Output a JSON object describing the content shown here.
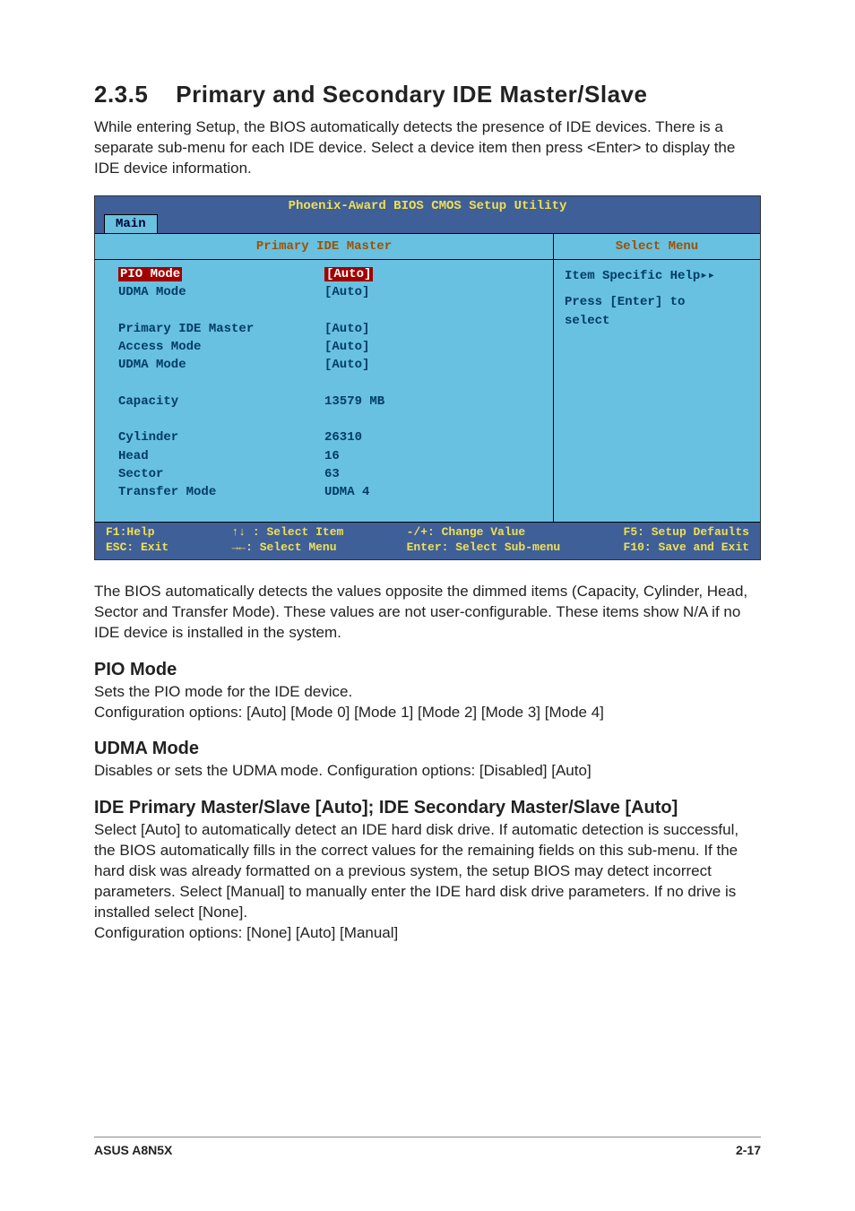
{
  "section": {
    "number": "2.3.5",
    "title": "Primary and Secondary IDE Master/Slave"
  },
  "intro": "While entering Setup, the BIOS automatically detects the presence of IDE devices. There is a separate sub-menu for each IDE device. Select a device item then press <Enter> to display the IDE device information.",
  "bios": {
    "utility_title": "Phoenix-Award BIOS CMOS Setup Utility",
    "tab": "Main",
    "left_heading": "Primary IDE Master",
    "right_heading": "Select Menu",
    "rows": [
      {
        "label": "PIO Mode",
        "value": "[Auto]",
        "highlight": true
      },
      {
        "label": "UDMA Mode",
        "value": "[Auto]"
      },
      {
        "label": "",
        "value": ""
      },
      {
        "label": "Primary IDE Master",
        "value": "[Auto]"
      },
      {
        "label": "Access Mode",
        "value": "[Auto]"
      },
      {
        "label": "UDMA Mode",
        "value": "[Auto]"
      },
      {
        "label": "",
        "value": ""
      },
      {
        "label": "Capacity",
        "value": "13579 MB"
      },
      {
        "label": "",
        "value": ""
      },
      {
        "label": "Cylinder",
        "value": "26310"
      },
      {
        "label": "Head",
        "value": "  16"
      },
      {
        "label": "Sector",
        "value": "  63"
      },
      {
        "label": "Transfer Mode",
        "value": "UDMA 4"
      }
    ],
    "help": {
      "line1": "Item Specific Help▸▸",
      "line2": "Press [Enter] to",
      "line3": "select"
    },
    "footer": {
      "c1a": "F1:Help",
      "c1b": "ESC: Exit",
      "c2a": "↑↓ : Select Item",
      "c2b": "→←: Select Menu",
      "c3a": "-/+: Change Value",
      "c3b": "Enter: Select Sub-menu",
      "c4a": "F5: Setup Defaults",
      "c4b": "F10: Save and Exit"
    }
  },
  "after_bios": "The BIOS automatically detects the values opposite the dimmed items (Capacity, Cylinder,  Head, Sector and Transfer Mode). These values are not user-configurable. These items show N/A if no IDE device is installed in the system.",
  "pio": {
    "heading": "PIO Mode",
    "line1": "Sets the PIO mode for the IDE device.",
    "line2": "Configuration options: [Auto] [Mode 0] [Mode 1] [Mode 2] [Mode 3] [Mode 4]"
  },
  "udma": {
    "heading": "UDMA Mode",
    "line1": "Disables or sets the UDMA mode. Configuration options: [Disabled] [Auto]"
  },
  "ide": {
    "heading": "IDE Primary Master/Slave [Auto]; IDE Secondary Master/Slave [Auto]",
    "body": "Select [Auto] to automatically detect an IDE hard disk drive. If automatic detection is successful, the BIOS automatically fills in the correct values for the remaining fields on this sub-menu. If the hard disk was already formatted on a previous system, the setup BIOS may detect incorrect parameters. Select [Manual] to manually enter the IDE hard disk drive parameters. If no drive is installed select [None].",
    "config": "Configuration options: [None] [Auto] [Manual]"
  },
  "footer": {
    "left": "ASUS A8N5X",
    "right": "2-17"
  }
}
